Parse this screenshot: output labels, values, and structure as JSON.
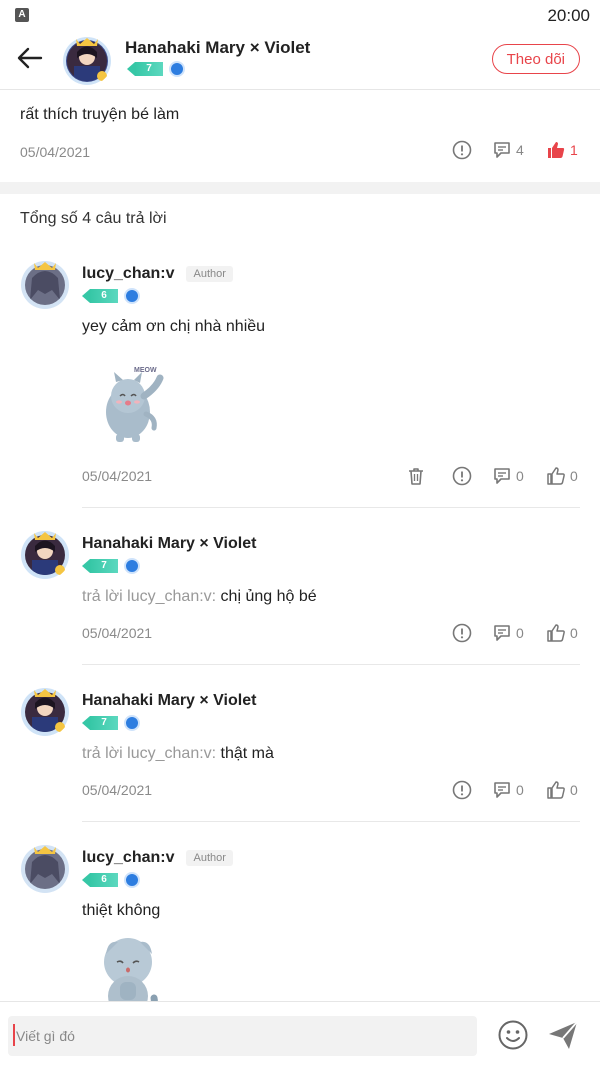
{
  "status_bar": {
    "app_icon_letter": "A",
    "time": "20:00"
  },
  "header": {
    "user_name": "Hanahaki Mary × Violet",
    "level": "7",
    "follow_label": "Theo dõi"
  },
  "main_comment": {
    "text": "rất thích truyện bé làm",
    "date": "05/04/2021",
    "reply_count": "4",
    "like_count": "1"
  },
  "replies_summary": "Tổng số 4 câu trả lời",
  "replies": [
    {
      "name": "lucy_chan:v",
      "author_tag": "Author",
      "level": "6",
      "text": "yey cảm ơn chị nhà nhiều",
      "date": "05/04/2021",
      "reply_count": "0",
      "like_count": "0"
    },
    {
      "name": "Hanahaki Mary × Violet",
      "level": "7",
      "prefix": "trả lời lucy_chan:v: ",
      "text": "chị ủng hộ bé",
      "date": "05/04/2021",
      "reply_count": "0",
      "like_count": "0"
    },
    {
      "name": "Hanahaki Mary × Violet",
      "level": "7",
      "prefix": "trả lời lucy_chan:v: ",
      "text": "thật mà",
      "date": "05/04/2021",
      "reply_count": "0",
      "like_count": "0"
    },
    {
      "name": "lucy_chan:v",
      "author_tag": "Author",
      "level": "6",
      "text": "thiệt không"
    }
  ],
  "sticker_1_caption": "MEOW",
  "input": {
    "placeholder": "Viết gì đó",
    "value": ""
  },
  "colors": {
    "accent": "#e8444a",
    "level": "#36c7a6",
    "verify": "#2d7de0"
  },
  "icons": [
    "back-arrow-icon",
    "report-icon",
    "comment-icon",
    "like-icon",
    "trash-icon",
    "emoji-icon",
    "send-icon",
    "verify-icon"
  ]
}
